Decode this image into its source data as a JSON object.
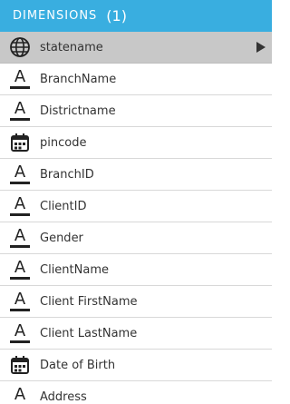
{
  "header": {
    "title": "DIMENSIONS",
    "count": "(1)"
  },
  "colors": {
    "header_bg": "#39aee0",
    "selected_row_bg": "#c8c8c8"
  },
  "dimensions": [
    {
      "label": "statename",
      "icon": "globe-icon",
      "selected": true
    },
    {
      "label": "BranchName",
      "icon": "text-type-icon"
    },
    {
      "label": "Districtname",
      "icon": "text-type-icon"
    },
    {
      "label": "pincode",
      "icon": "calendar-icon"
    },
    {
      "label": "BranchID",
      "icon": "text-type-icon"
    },
    {
      "label": "ClientID",
      "icon": "text-type-icon"
    },
    {
      "label": "Gender",
      "icon": "text-type-icon"
    },
    {
      "label": "ClientName",
      "icon": "text-type-icon"
    },
    {
      "label": "Client FirstName",
      "icon": "text-type-icon"
    },
    {
      "label": "Client LastName",
      "icon": "text-type-icon"
    },
    {
      "label": "Date of Birth",
      "icon": "calendar-icon"
    },
    {
      "label": "Address",
      "icon": "text-type-icon"
    }
  ]
}
